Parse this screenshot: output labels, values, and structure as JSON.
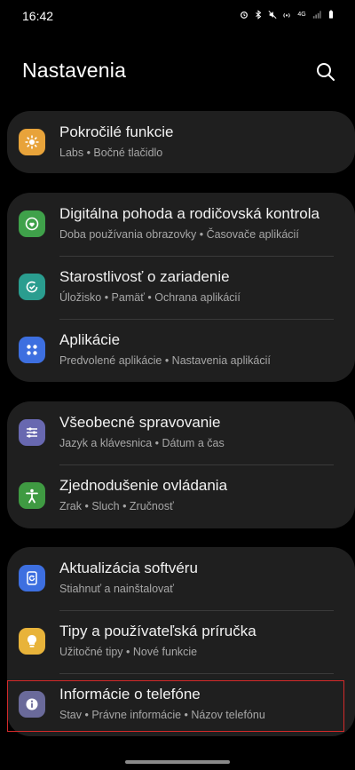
{
  "status": {
    "time": "16:42",
    "icons": [
      "alarm-icon",
      "bluetooth-icon",
      "mute-icon",
      "hotspot-icon",
      "4g-icon",
      "signal-icon",
      "battery-icon"
    ],
    "network": "4G"
  },
  "header": {
    "title": "Nastavenia",
    "search_icon": "search-icon"
  },
  "groups": [
    {
      "items": [
        {
          "title": "Pokročilé funkcie",
          "subtitle": "Labs • Bočné tlačidlo",
          "icon": "advanced-features-icon",
          "color": "#e8a33a"
        }
      ]
    },
    {
      "items": [
        {
          "title": "Digitálna pohoda a rodičovská kontrola",
          "subtitle": "Doba používania obrazovky • Časovače aplikácií",
          "icon": "digital-wellbeing-icon",
          "color": "#3fa14a"
        },
        {
          "title": "Starostlivosť o zariadenie",
          "subtitle": "Úložisko • Pamäť • Ochrana aplikácií",
          "icon": "device-care-icon",
          "color": "#2a9d8f"
        },
        {
          "title": "Aplikácie",
          "subtitle": "Predvolené aplikácie • Nastavenia aplikácií",
          "icon": "apps-icon",
          "color": "#3d6fe0"
        }
      ]
    },
    {
      "items": [
        {
          "title": "Všeobecné spravovanie",
          "subtitle": "Jazyk a klávesnica • Dátum a čas",
          "icon": "general-management-icon",
          "color": "#6868b0"
        },
        {
          "title": "Zjednodušenie ovládania",
          "subtitle": "Zrak • Sluch • Zručnosť",
          "icon": "accessibility-icon",
          "color": "#3f9a42"
        }
      ]
    },
    {
      "items": [
        {
          "title": "Aktualizácia softvéru",
          "subtitle": "Stiahnuť a nainštalovať",
          "icon": "software-update-icon",
          "color": "#3d6fe0"
        },
        {
          "title": "Tipy a používateľská príručka",
          "subtitle": "Užitočné tipy • Nové funkcie",
          "icon": "tips-icon",
          "color": "#e8b33a"
        },
        {
          "title": "Informácie o telefóne",
          "subtitle": "Stav • Právne informácie • Názov telefónu",
          "icon": "about-phone-icon",
          "color": "#6a6a9a"
        }
      ]
    }
  ],
  "highlight_color": "#d32a2a"
}
